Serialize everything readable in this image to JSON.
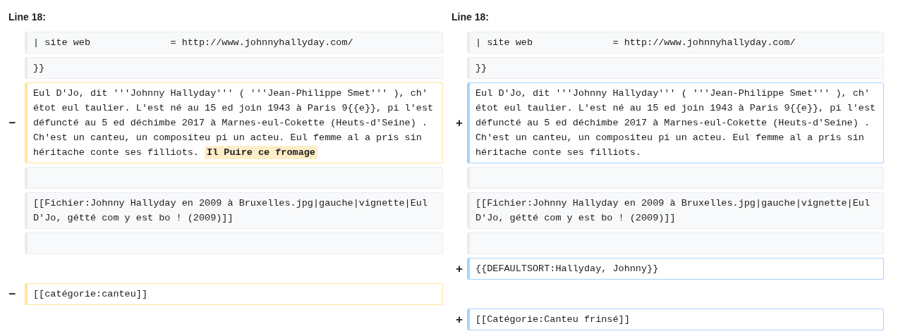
{
  "headers": [
    "Line 18:",
    "Line 18:"
  ],
  "rows": [
    {
      "left": {
        "kind": "context",
        "parts": [
          {
            "text": "| site web              = http://www.johnnyhallyday.com/",
            "highlighted": false
          }
        ]
      },
      "right": {
        "kind": "context",
        "parts": [
          {
            "text": "| site web              = http://www.johnnyhallyday.com/",
            "highlighted": false
          }
        ]
      }
    },
    {
      "left": {
        "kind": "context",
        "parts": [
          {
            "text": "}}",
            "highlighted": false
          }
        ]
      },
      "right": {
        "kind": "context",
        "parts": [
          {
            "text": "}}",
            "highlighted": false
          }
        ]
      }
    },
    {
      "left": {
        "kind": "deleted",
        "marker": "−",
        "parts": [
          {
            "text": "Eul D'Jo, dit '''Johnny Hallyday''' ( '''Jean-Philippe Smet''' ), ch' étot eul taulier. L'est né au 15 ed join 1943 à Paris 9{{e}}, pi l'est défuncté au 5 ed déchimbe 2017 à Marnes-eul-Cokette (Heuts-d'Seine) . Ch'est un canteu, un compositeu pi un acteu. Eul femme al a pris sin héritache conte ses filliots. ",
            "highlighted": false
          },
          {
            "text": "Il Puire ce fromage",
            "highlighted": true
          }
        ]
      },
      "right": {
        "kind": "added",
        "marker": "+",
        "parts": [
          {
            "text": "Eul D'Jo, dit '''Johnny Hallyday''' ( '''Jean-Philippe Smet''' ), ch' étot eul taulier. L'est né au 15 ed join 1943 à Paris 9{{e}}, pi l'est défuncté au 5 ed déchimbe 2017 à Marnes-eul-Cokette (Heuts-d'Seine) . Ch'est un canteu, un compositeu pi un acteu. Eul femme al a pris sin héritache conte ses filliots.",
            "highlighted": false
          }
        ]
      }
    },
    {
      "left": {
        "kind": "context"
      },
      "right": {
        "kind": "context"
      }
    },
    {
      "left": {
        "kind": "context",
        "parts": [
          {
            "text": "[[Fichier:Johnny Hallyday en 2009 à Bruxelles.jpg|gauche|vignette|Eul D'Jo, gétté com y est bo ! (2009)]]",
            "highlighted": false
          }
        ]
      },
      "right": {
        "kind": "context",
        "parts": [
          {
            "text": "[[Fichier:Johnny Hallyday en 2009 à Bruxelles.jpg|gauche|vignette|Eul D'Jo, gétté com y est bo ! (2009)]]",
            "highlighted": false
          }
        ]
      }
    },
    {
      "left": {
        "kind": "context"
      },
      "right": {
        "kind": "context"
      }
    },
    {
      "left": {
        "kind": "empty"
      },
      "right": {
        "kind": "added",
        "marker": "+",
        "parts": [
          {
            "text": "{{DEFAULTSORT:Hallyday, Johnny}}",
            "highlighted": false
          }
        ]
      }
    },
    {
      "left": {
        "kind": "deleted",
        "marker": "−",
        "parts": [
          {
            "text": "[[catégorie:canteu]]",
            "highlighted": false
          }
        ]
      },
      "right": {
        "kind": "empty"
      }
    },
    {
      "left": {
        "kind": "empty"
      },
      "right": {
        "kind": "added",
        "marker": "+",
        "parts": [
          {
            "text": "[[Catégorie:Canteu frinsé]]",
            "highlighted": false
          }
        ]
      }
    }
  ]
}
